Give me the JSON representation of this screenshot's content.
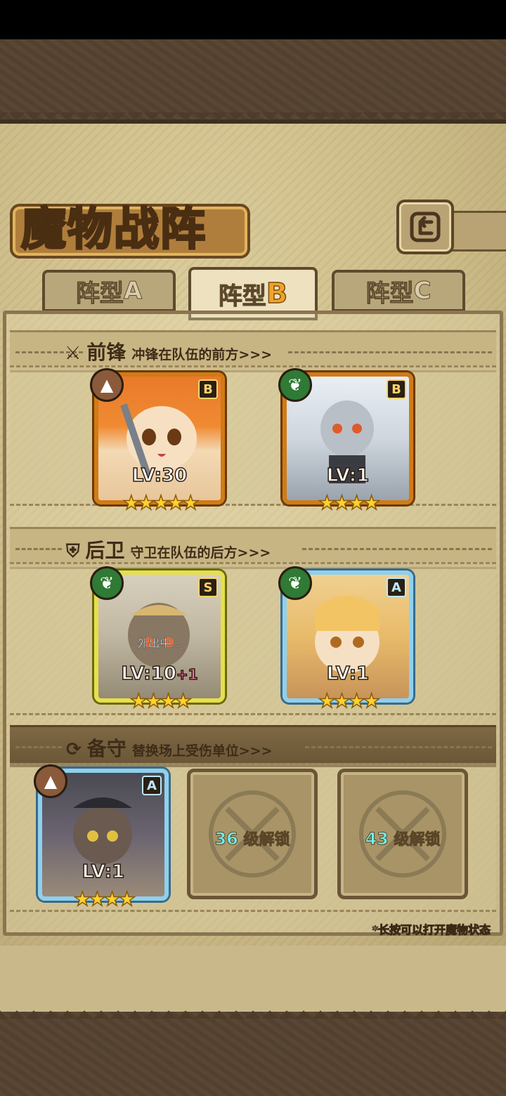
{
  "title": "魔物战阵",
  "back_icon": "back-arrow-icon",
  "tabs": [
    {
      "prefix": "阵型",
      "letter": "A",
      "active": false
    },
    {
      "prefix": "阵型",
      "letter": "B",
      "active": true
    },
    {
      "prefix": "阵型",
      "letter": "C",
      "active": false
    }
  ],
  "sections": {
    "front": {
      "icon": "sword-icon",
      "title": "前锋",
      "desc": "冲锋在队伍的前方>>>"
    },
    "rear": {
      "icon": "shield-icon",
      "title": "后卫",
      "desc": "守卫在队伍的后方>>>"
    },
    "reserve": {
      "icon": "swap-icon",
      "title": "备守",
      "desc": "替换场上受伤单位>>>"
    }
  },
  "front_cards": [
    {
      "rank": "B",
      "element": "earth",
      "level": "LV:30",
      "stars": "★★★★★",
      "frame": "orange"
    },
    {
      "rank": "B",
      "element": "grass",
      "level": "LV:1",
      "stars": "★★★★",
      "frame": "orange"
    }
  ],
  "rear_cards": [
    {
      "rank": "S",
      "element": "grass",
      "level": "LV:10",
      "level_bonus": "+1",
      "status": "外出中...",
      "stars": "★★★★",
      "frame": "yellow"
    },
    {
      "rank": "A",
      "element": "grass",
      "level": "LV:1",
      "stars": "★★★★",
      "frame": "blue"
    }
  ],
  "reserve_cards": [
    {
      "rank": "A",
      "element": "earth",
      "level": "LV:1",
      "stars": "★★★★",
      "frame": "blue"
    }
  ],
  "locked_slots": [
    {
      "unlock_level": "36",
      "unlock_text": "级解锁"
    },
    {
      "unlock_level": "43",
      "unlock_text": "级解锁"
    }
  ],
  "hint": "*长按可以打开魔物状态",
  "colors": {
    "accent_orange": "#d07b16",
    "rank_gold": "#ffd36a",
    "unlock_cyan": "#6cf0f0"
  }
}
